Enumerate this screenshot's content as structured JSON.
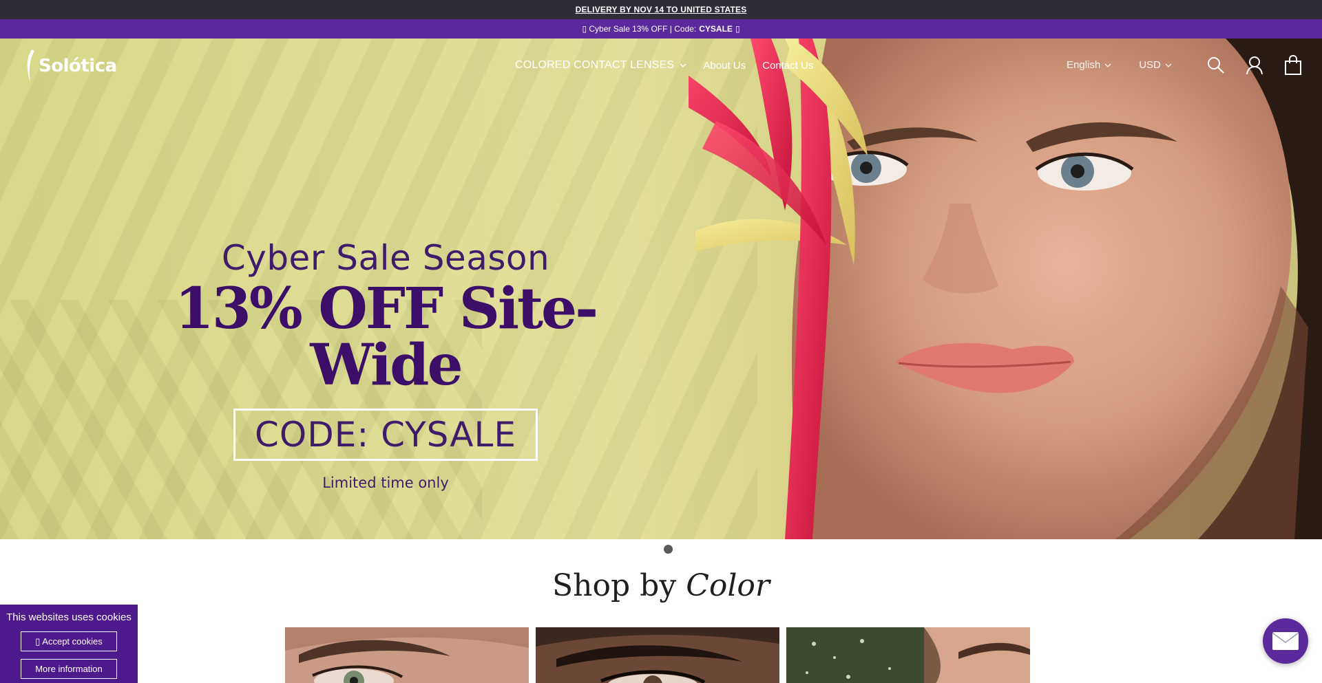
{
  "announcements": {
    "delivery": "DELIVERY BY NOV 14 TO UNITED STATES",
    "promo_prefix": "▯ Cyber Sale 13% OFF | Code:",
    "promo_code": "CYSALE",
    "promo_suffix": "▯"
  },
  "header": {
    "logo_text": "Solótica",
    "nav": [
      {
        "label": "COLORED CONTACT LENSES"
      },
      {
        "label": "About Us"
      },
      {
        "label": "Contact Us"
      }
    ],
    "language": "English",
    "currency": "USD",
    "icons": [
      "search-icon",
      "account-icon",
      "cart-icon"
    ]
  },
  "hero": {
    "kicker": "Cyber Sale Season",
    "headline": "13% OFF Site-Wide",
    "code": "CODE: CYSALE",
    "subtext": "Limited time only",
    "slides_total": 1,
    "active_slide": 1
  },
  "shop": {
    "title_plain": "Shop by",
    "title_italic": "Color"
  },
  "cookie": {
    "title": "This websites uses cookies",
    "accept_label": "▯ Accept cookies",
    "more_label": "More information"
  },
  "colors": {
    "delivery_bar": "#2f2e38",
    "promo_bar": "#5a2a9c",
    "hero_text": "#3b0f68",
    "cookie_bg": "#4d1a8c"
  }
}
